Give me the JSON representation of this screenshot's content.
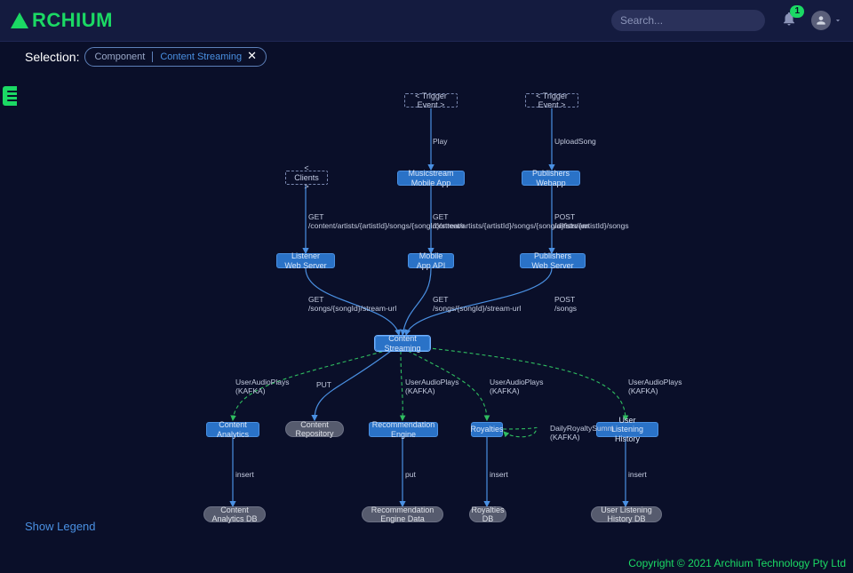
{
  "app": {
    "name_text": "RCHIUM"
  },
  "search": {
    "placeholder": "Search..."
  },
  "notifications": {
    "count": "1"
  },
  "selection": {
    "label": "Selection:",
    "chip_type": "Component",
    "chip_name": "Content Streaming"
  },
  "show_legend": "Show Legend",
  "footer": "Copyright © 2021 Archium Technology Pty Ltd",
  "diagram": {
    "nodes": {
      "trig1": "< Trigger Event >",
      "trig2": "< Trigger Event >",
      "clients": "< Clients >",
      "mobileApp": "Musicstream Mobile App",
      "pubWeb": "Publishers Webapp",
      "listenerServer": "Listener Web Server",
      "mobileApi": "Mobile App API",
      "pubServer": "Publishers Web Server",
      "contentStreaming": "Content Streaming",
      "contentAnalytics": "Content Analytics",
      "contentRepo": "Content Repository",
      "recoEngine": "Recommendation Engine",
      "royalties": "Royalties",
      "userHistory": "User Listening History",
      "contentAnalyticsDb": "Content Analytics DB",
      "recoDb": "Recommendation Engine Data",
      "royaltiesDb": "Royalties DB",
      "userHistoryDb": "User Listening History DB"
    },
    "edge_labels": {
      "play": "Play",
      "uploadSong": "UploadSong",
      "getStream1": "GET\n/content/artists/{artistId}/songs/{songId}/stream",
      "getStream2": "GET\n/content/artists/{artistId}/songs/{songId}/stream",
      "postSongs": "POST\n/artists/{artistId}/songs",
      "getUrl1": "GET\n/songs/{songId}/stream-url",
      "getUrl2": "GET\n/songs/{songId}/stream-url",
      "postSongs2": "POST\n/songs",
      "uap1": "UserAudioPlays\n(KAFKA)",
      "put": "PUT",
      "uap2": "UserAudioPlays\n(KAFKA)",
      "uap3": "UserAudioPlays\n(KAFKA)",
      "uap4": "UserAudioPlays\n(KAFKA)",
      "dailyRoyalty": "DailyRoyaltySumm\n(KAFKA)",
      "insert1": "insert",
      "put2": "put",
      "insert2": "insert",
      "insert3": "insert"
    }
  }
}
